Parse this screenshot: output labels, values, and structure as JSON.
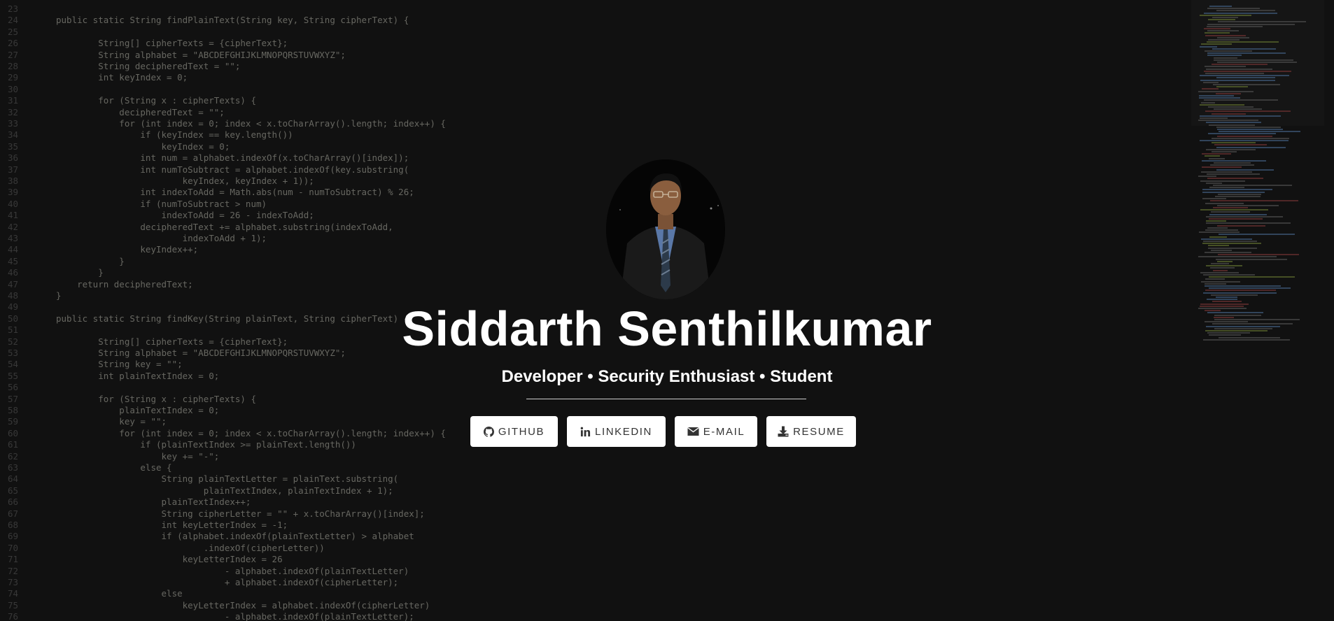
{
  "profile": {
    "name": "Siddarth Senthilkumar",
    "tagline": "Developer • Security Enthusiast • Student",
    "photo_alt": "Profile photo of Siddarth Senthilkumar"
  },
  "buttons": [
    {
      "label": "GITHUB",
      "icon": "github-icon"
    },
    {
      "label": "LINKEDIN",
      "icon": "linkedin-icon"
    },
    {
      "label": "E-MAIL",
      "icon": "envelope-icon"
    },
    {
      "label": "RESUME",
      "icon": "download-icon"
    }
  ],
  "colors": {
    "background": "#111111",
    "text": "#ffffff",
    "button_bg": "#ffffff",
    "button_text": "#333333"
  },
  "code_background": [
    {
      "n": "23",
      "text": ""
    },
    {
      "n": "24",
      "text": "public static String findPlainText(String key, String cipherText) {"
    },
    {
      "n": "25",
      "text": ""
    },
    {
      "n": "26",
      "text": "        String[] cipherTexts = {cipherText};"
    },
    {
      "n": "27",
      "text": "        String alphabet = \"ABCDEFGHIJKLMNOPQRSTUVWXYZ\";"
    },
    {
      "n": "28",
      "text": "        String decipheredText = \"\";"
    },
    {
      "n": "29",
      "text": "        int keyIndex = 0;"
    },
    {
      "n": "30",
      "text": ""
    },
    {
      "n": "31",
      "text": "        for (String x : cipherTexts) {"
    },
    {
      "n": "32",
      "text": "            decipheredText = \"\";"
    },
    {
      "n": "33",
      "text": "            for (int index = 0; index < x.toCharArray().length; index++) {"
    },
    {
      "n": "34",
      "text": "                if (keyIndex == key.length())"
    },
    {
      "n": "35",
      "text": "                    keyIndex = 0;"
    },
    {
      "n": "36",
      "text": "                int num = alphabet.indexOf(x.toCharArray()[index]);"
    },
    {
      "n": "37",
      "text": "                int numToSubtract = alphabet.indexOf(key.substring("
    },
    {
      "n": "38",
      "text": "                        keyIndex, keyIndex + 1));"
    },
    {
      "n": "39",
      "text": "                int indexToAdd = Math.abs(num - numToSubtract) % 26;"
    },
    {
      "n": "40",
      "text": "                if (numToSubtract > num)"
    },
    {
      "n": "41",
      "text": "                    indexToAdd = 26 - indexToAdd;"
    },
    {
      "n": "42",
      "text": "                decipheredText += alphabet.substring(indexToAdd,"
    },
    {
      "n": "43",
      "text": "                        indexToAdd + 1);"
    },
    {
      "n": "44",
      "text": "                keyIndex++;"
    },
    {
      "n": "45",
      "text": "            }"
    },
    {
      "n": "46",
      "text": "        }"
    },
    {
      "n": "47",
      "text": "    return decipheredText;"
    },
    {
      "n": "48",
      "text": "}"
    },
    {
      "n": "49",
      "text": ""
    },
    {
      "n": "50",
      "text": "public static String findKey(String plainText, String cipherText) {"
    },
    {
      "n": "51",
      "text": ""
    },
    {
      "n": "52",
      "text": "        String[] cipherTexts = {cipherText};"
    },
    {
      "n": "53",
      "text": "        String alphabet = \"ABCDEFGHIJKLMNOPQRSTUVWXYZ\";"
    },
    {
      "n": "54",
      "text": "        String key = \"\";"
    },
    {
      "n": "55",
      "text": "        int plainTextIndex = 0;"
    },
    {
      "n": "56",
      "text": ""
    },
    {
      "n": "57",
      "text": "        for (String x : cipherTexts) {"
    },
    {
      "n": "58",
      "text": "            plainTextIndex = 0;"
    },
    {
      "n": "59",
      "text": "            key = \"\";"
    },
    {
      "n": "60",
      "text": "            for (int index = 0; index < x.toCharArray().length; index++) {"
    },
    {
      "n": "61",
      "text": "                if (plainTextIndex >= plainText.length())"
    },
    {
      "n": "62",
      "text": "                    key += \"-\";"
    },
    {
      "n": "63",
      "text": "                else {"
    },
    {
      "n": "64",
      "text": "                    String plainTextLetter = plainText.substring("
    },
    {
      "n": "65",
      "text": "                            plainTextIndex, plainTextIndex + 1);"
    },
    {
      "n": "66",
      "text": "                    plainTextIndex++;"
    },
    {
      "n": "67",
      "text": "                    String cipherLetter = \"\" + x.toCharArray()[index];"
    },
    {
      "n": "68",
      "text": "                    int keyLetterIndex = -1;"
    },
    {
      "n": "69",
      "text": "                    if (alphabet.indexOf(plainTextLetter) > alphabet"
    },
    {
      "n": "70",
      "text": "                            .indexOf(cipherLetter))"
    },
    {
      "n": "71",
      "text": "                        keyLetterIndex = 26"
    },
    {
      "n": "72",
      "text": "                                - alphabet.indexOf(plainTextLetter)"
    },
    {
      "n": "73",
      "text": "                                + alphabet.indexOf(cipherLetter);"
    },
    {
      "n": "74",
      "text": "                    else"
    },
    {
      "n": "75",
      "text": "                        keyLetterIndex = alphabet.indexOf(cipherLetter)"
    },
    {
      "n": "76",
      "text": "                                - alphabet.indexOf(plainTextLetter);"
    }
  ]
}
